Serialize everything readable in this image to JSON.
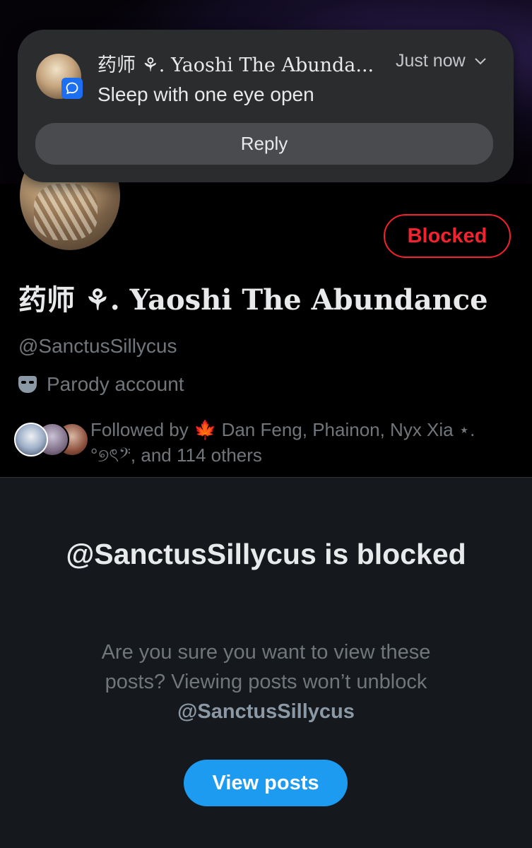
{
  "notification": {
    "sender": "药师 ⚘. Yaoshi The Abunda...",
    "time": "Just now",
    "message": "Sleep with one eye open",
    "reply_label": "Reply"
  },
  "profile": {
    "blocked_label": "Blocked",
    "display_name": "药师 ⚘. Yaoshi The Abundance",
    "handle": "@SanctusSillycus",
    "parody_label": "Parody account",
    "followed_by_prefix": "Followed by",
    "followed_by_names": "🍁 Dan Feng, Phainon, Nyx Xia ⋆.°୭ৎ𝄢, and 114 others"
  },
  "blocked_notice": {
    "title": "@SanctusSillycus is blocked",
    "body": "Are you sure you want to view these posts? Viewing posts won’t unblock",
    "body_handle": "@SanctusSillycus",
    "view_posts_label": "View posts"
  },
  "colors": {
    "blocked_red": "#f4212e",
    "accent_blue": "#1d9bf0",
    "muted_text": "#71767b"
  }
}
